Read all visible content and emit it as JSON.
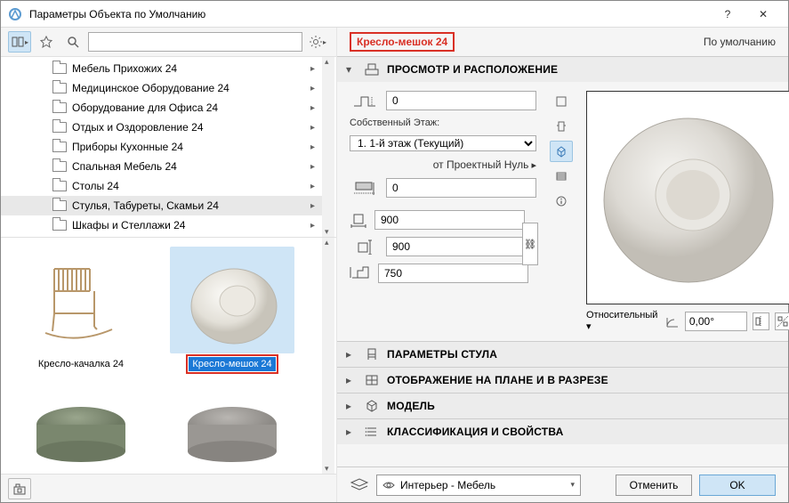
{
  "window": {
    "title": "Параметры Объекта по Умолчанию",
    "help": "?",
    "close": "✕"
  },
  "object": {
    "name": "Кресло-мешок 24",
    "default_link": "По умолчанию"
  },
  "tree": {
    "items": [
      {
        "label": "Мебель Прихожих 24",
        "selected": false
      },
      {
        "label": "Медицинское Оборудование 24",
        "selected": false
      },
      {
        "label": "Оборудование для Офиса 24",
        "selected": false
      },
      {
        "label": "Отдых и Оздоровление 24",
        "selected": false
      },
      {
        "label": "Приборы Кухонные 24",
        "selected": false
      },
      {
        "label": "Спальная Мебель 24",
        "selected": false
      },
      {
        "label": "Столы 24",
        "selected": false
      },
      {
        "label": "Стулья, Табуреты, Скамьи 24",
        "selected": true
      },
      {
        "label": "Шкафы и Стеллажи 24",
        "selected": false
      }
    ]
  },
  "thumbs": {
    "items": [
      {
        "label": "Кресло-качалка 24",
        "selected": false,
        "kind": "rocking-chair"
      },
      {
        "label": "Кресло-мешок 24",
        "selected": true,
        "kind": "beanbag"
      },
      {
        "label": "",
        "selected": false,
        "kind": "ottoman-green"
      },
      {
        "label": "",
        "selected": false,
        "kind": "ottoman-grey"
      }
    ]
  },
  "panels": [
    {
      "title": "ПРОСМОТР И РАСПОЛОЖЕНИЕ",
      "open": true,
      "icon": "placement"
    },
    {
      "title": "ПАРАМЕТРЫ СТУЛА",
      "open": false,
      "icon": "chair"
    },
    {
      "title": "ОТОБРАЖЕНИЕ НА ПЛАНЕ И В РАЗРЕЗЕ",
      "open": false,
      "icon": "plan"
    },
    {
      "title": "МОДЕЛЬ",
      "open": false,
      "icon": "cube"
    },
    {
      "title": "КЛАССИФИКАЦИЯ И СВОЙСТВА",
      "open": false,
      "icon": "list"
    }
  ],
  "fields": {
    "top_elev": "0",
    "home_story_label": "Собственный Этаж:",
    "home_story_value": "1. 1-й этаж (Текущий)",
    "project_zero_label": "от Проектный Нуль",
    "bottom_elev": "0",
    "dim_x": "900",
    "dim_y": "900",
    "dim_z": "750",
    "relative_label": "Относительный ▾",
    "rotation": "0,00°"
  },
  "footer": {
    "layer": "Интерьер - Мебель",
    "cancel": "Отменить",
    "ok": "OK"
  }
}
